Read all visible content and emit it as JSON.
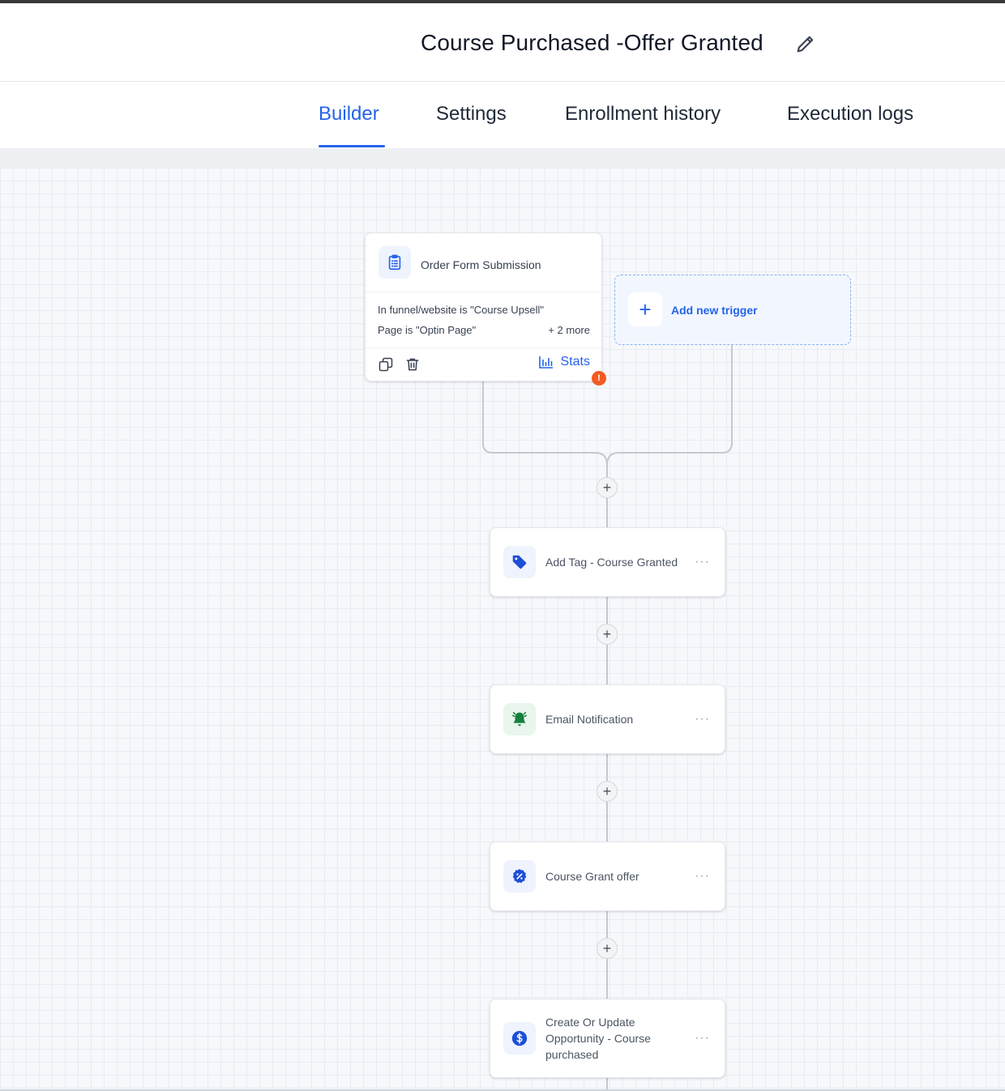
{
  "header": {
    "title": "Course Purchased -Offer Granted"
  },
  "tabs": [
    {
      "label": "Builder",
      "active": true
    },
    {
      "label": "Settings",
      "active": false
    },
    {
      "label": "Enrollment history",
      "active": false
    },
    {
      "label": "Execution logs",
      "active": false
    }
  ],
  "trigger": {
    "title": "Order Form Submission",
    "line1": "In funnel/website is \"Course Upsell\"",
    "line2": "Page is \"Optin Page\"",
    "more": "+ 2 more",
    "stats_label": "Stats",
    "alert": "!"
  },
  "add_trigger": {
    "label": "Add new trigger"
  },
  "actions": [
    {
      "label": "Add Tag - Course Granted",
      "icon": "tag-icon",
      "color": "#1d4ed8",
      "bg": "#eef3fd"
    },
    {
      "label": "Email Notification",
      "icon": "bell-icon",
      "color": "#15803d",
      "bg": "#e8f6ee"
    },
    {
      "label": "Course Grant offer",
      "icon": "percent-badge-icon",
      "color": "#1d4ed8",
      "bg": "#eef3fd"
    },
    {
      "label": "Create Or Update Opportunity - Course purchased",
      "icon": "dollar-icon",
      "color": "#1d4ed8",
      "bg": "#eef3fd"
    }
  ],
  "colors": {
    "accent": "#2563eb",
    "alert": "#f25c22"
  }
}
